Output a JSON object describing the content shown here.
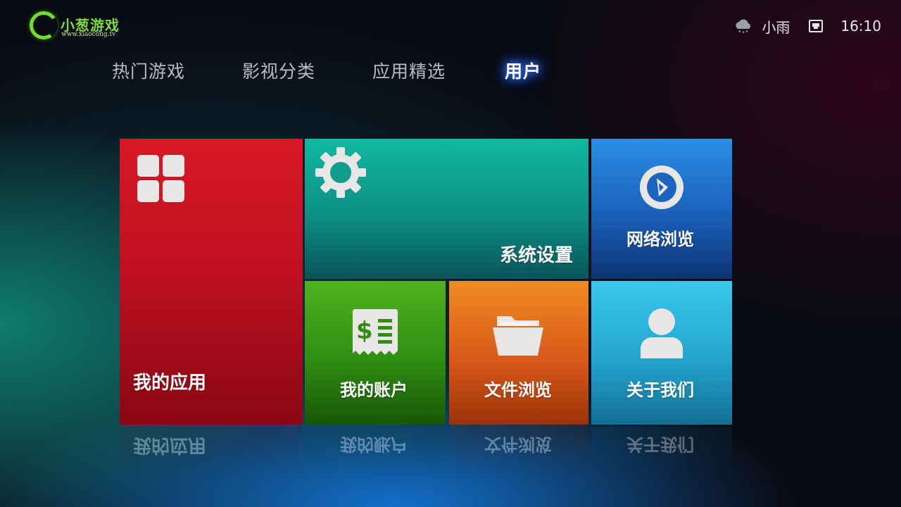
{
  "header": {
    "logo_text": "小葱游戏",
    "logo_url": "www.xiaocong.tv",
    "weather": "小雨",
    "time": "16:10"
  },
  "tabs": [
    {
      "label": "热门游戏",
      "active": false
    },
    {
      "label": "影视分类",
      "active": false
    },
    {
      "label": "应用精选",
      "active": false
    },
    {
      "label": "用户",
      "active": true
    }
  ],
  "tiles": {
    "my_apps": {
      "label": "我的应用",
      "icon": "grid-icon",
      "color": "#c01121"
    },
    "settings": {
      "label": "系统设置",
      "icon": "gear-icon",
      "color": "#0c8f85"
    },
    "web": {
      "label": "网络浏览",
      "icon": "compass-icon",
      "color": "#1a5fb9"
    },
    "account": {
      "label": "我的账户",
      "icon": "receipt-icon",
      "color": "#2f8d12"
    },
    "files": {
      "label": "文件浏览",
      "icon": "folder-icon",
      "color": "#d9591a"
    },
    "about": {
      "label": "关于我们",
      "icon": "user-icon",
      "color": "#23a4cf"
    }
  }
}
